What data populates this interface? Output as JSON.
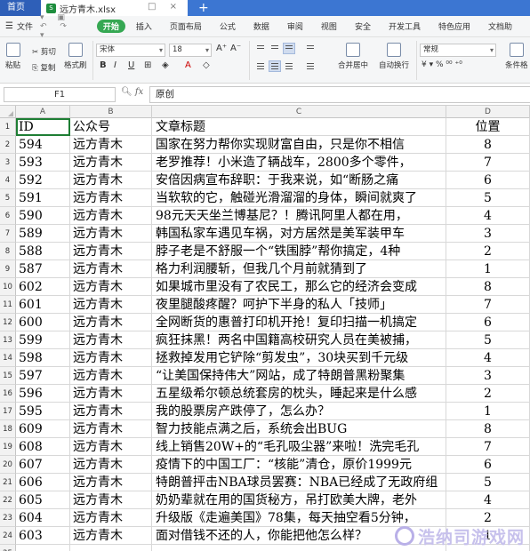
{
  "tabs": {
    "home": "首页",
    "file": "远方青木.xlsx",
    "file_icon": "S",
    "new_tab": "+"
  },
  "menu": {
    "file": "文件",
    "items": [
      "开始",
      "插入",
      "页面布局",
      "公式",
      "数据",
      "审阅",
      "视图",
      "安全",
      "开发工具",
      "特色应用",
      "文档助"
    ]
  },
  "toolbar": {
    "paste": "粘贴",
    "cut": "剪切",
    "copy": "复制",
    "format_painter": "格式刷",
    "font_name": "宋体",
    "font_size": "18",
    "merge_center": "合并居中",
    "wrap_text": "自动换行",
    "number_format": "常规",
    "conditional_format": "条件格"
  },
  "formula_bar": {
    "cell_ref": "F1",
    "fx": "fx",
    "content": "原创"
  },
  "columns": [
    "A",
    "B",
    "C",
    "D"
  ],
  "rows": [
    {
      "n": "1",
      "a": "ID",
      "b": "公众号",
      "c": "文章标题",
      "d": "位置"
    },
    {
      "n": "2",
      "a": "594",
      "b": "远方青木",
      "c": "国家在努力帮你实现财富自由，只是你不相信",
      "d": "8"
    },
    {
      "n": "3",
      "a": "593",
      "b": "远方青木",
      "c": "老罗推荐！小米造了辆战车，2800多个零件，",
      "d": "7"
    },
    {
      "n": "4",
      "a": "592",
      "b": "远方青木",
      "c": "安倍因病宣布辞职：于我来说，如“断肠之痛",
      "d": "6"
    },
    {
      "n": "5",
      "a": "591",
      "b": "远方青木",
      "c": "当软软的它，触碰光滑溜溜的身体，瞬间就爽了",
      "d": "5"
    },
    {
      "n": "6",
      "a": "590",
      "b": "远方青木",
      "c": "98元天天坐兰博基尼？！腾讯阿里人都在用，",
      "d": "4"
    },
    {
      "n": "7",
      "a": "589",
      "b": "远方青木",
      "c": "韩国私家车遇见车祸，对方居然是美军装甲车",
      "d": "3"
    },
    {
      "n": "8",
      "a": "588",
      "b": "远方青木",
      "c": "脖子老是不舒服一个“铁围脖”帮你搞定，4种",
      "d": "2"
    },
    {
      "n": "9",
      "a": "587",
      "b": "远方青木",
      "c": "格力利润腰斩，但我几个月前就猜到了",
      "d": "1"
    },
    {
      "n": "10",
      "a": "602",
      "b": "远方青木",
      "c": "如果城市里没有了农民工，那么它的经济会变成",
      "d": "8"
    },
    {
      "n": "11",
      "a": "601",
      "b": "远方青木",
      "c": "夜里腿酸疼醒？呵护下半身的私人「技师」",
      "d": "7"
    },
    {
      "n": "12",
      "a": "600",
      "b": "远方青木",
      "c": "全网断货的惠普打印机开抢！复印扫描一机搞定",
      "d": "6"
    },
    {
      "n": "13",
      "a": "599",
      "b": "远方青木",
      "c": "疯狂抹黑！两名中国籍高校研究人员在美被捕，",
      "d": "5"
    },
    {
      "n": "14",
      "a": "598",
      "b": "远方青木",
      "c": "拯救掉发用它铲除“剪发虫”，30块买到千元级",
      "d": "4"
    },
    {
      "n": "15",
      "a": "597",
      "b": "远方青木",
      "c": "“让美国保持伟大”网站，成了特朗普黑粉聚集",
      "d": "3"
    },
    {
      "n": "16",
      "a": "596",
      "b": "远方青木",
      "c": "五星级希尔顿总统套房的枕头，睡起来是什么感",
      "d": "2"
    },
    {
      "n": "17",
      "a": "595",
      "b": "远方青木",
      "c": "我的股票房产跌停了，怎么办？",
      "d": "1"
    },
    {
      "n": "18",
      "a": "609",
      "b": "远方青木",
      "c": "智力技能点满之后，系统会出BUG",
      "d": "8"
    },
    {
      "n": "19",
      "a": "608",
      "b": "远方青木",
      "c": "线上销售20W+的“毛孔吸尘器”来啦！洗完毛孔",
      "d": "7"
    },
    {
      "n": "20",
      "a": "607",
      "b": "远方青木",
      "c": "疫情下的中国工厂：“核能”清仓，原价1999元",
      "d": "6"
    },
    {
      "n": "21",
      "a": "606",
      "b": "远方青木",
      "c": "特朗普抨击NBA球员罢赛：NBA已经成了无政府组",
      "d": "5"
    },
    {
      "n": "22",
      "a": "605",
      "b": "远方青木",
      "c": "奶奶辈就在用的国货秘方，吊打欧美大牌，老外",
      "d": "4"
    },
    {
      "n": "23",
      "a": "604",
      "b": "远方青木",
      "c": "升级版《走遍美国》78集，每天抽空看5分钟，",
      "d": "2"
    },
    {
      "n": "24",
      "a": "603",
      "b": "远方青木",
      "c": "面对借钱不还的人，你能把他怎么样？",
      "d": "1"
    },
    {
      "n": "25",
      "a": "",
      "b": "",
      "c": "",
      "d": ""
    }
  ],
  "watermark": "浩纳司游戏网"
}
